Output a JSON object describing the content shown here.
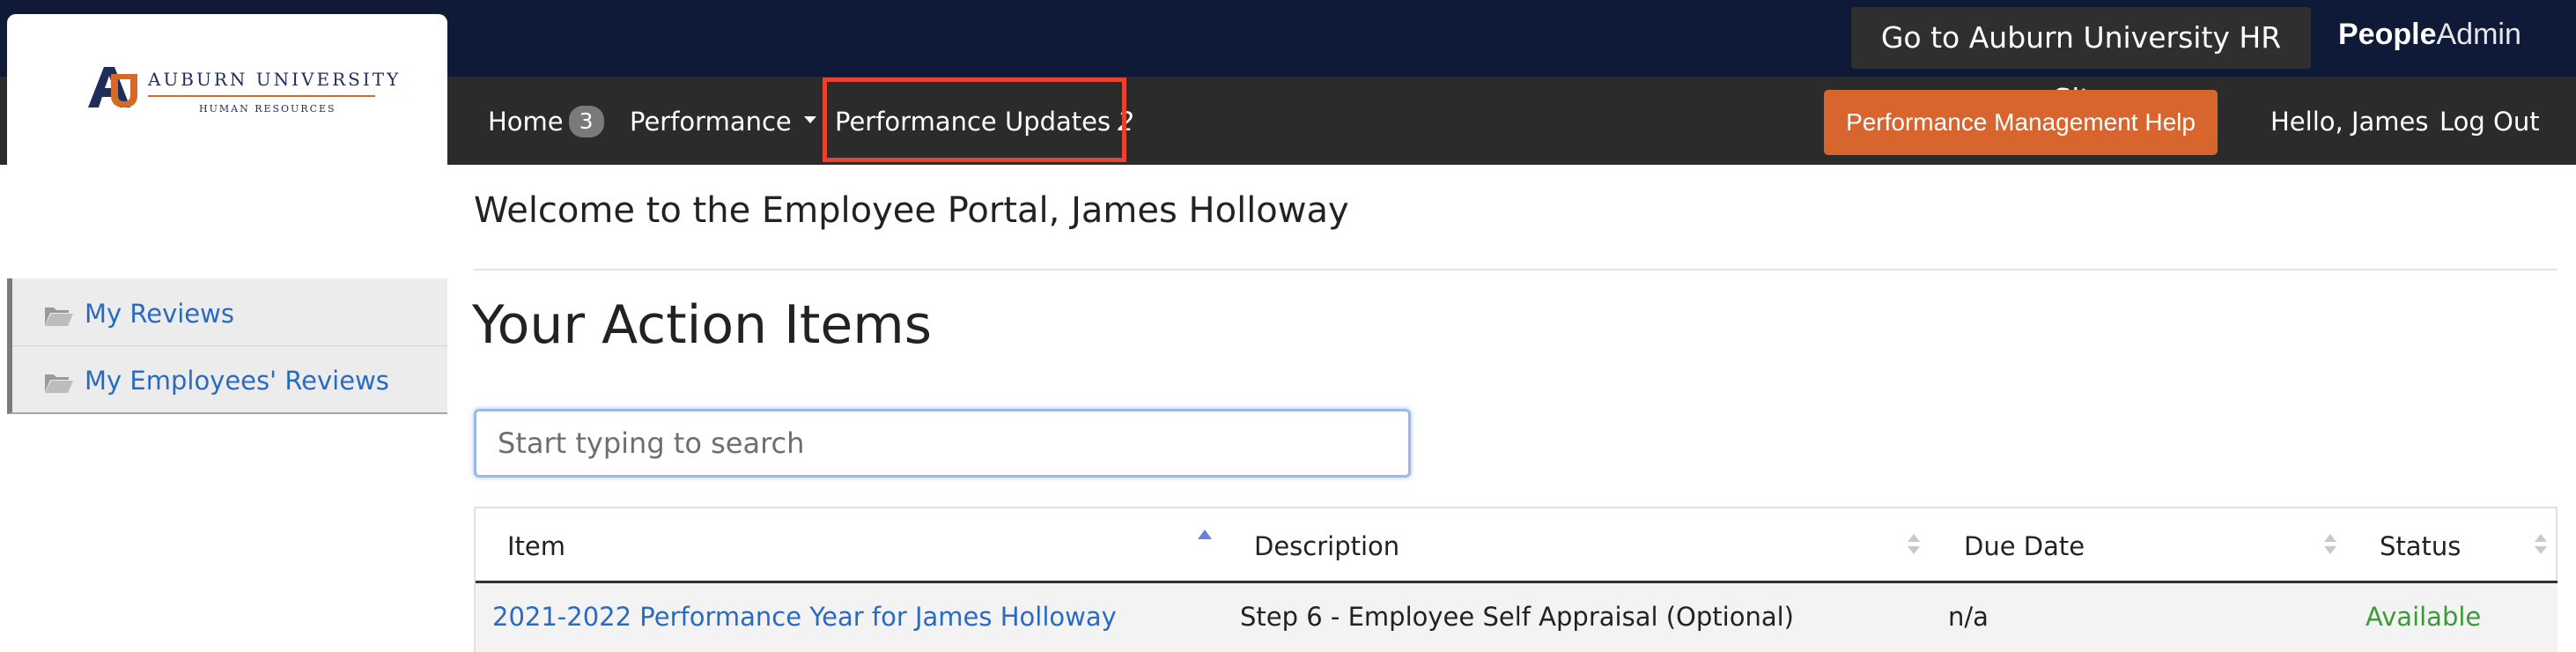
{
  "header": {
    "hr_site_button": "Go to Auburn University HR Site",
    "brand_bold": "People",
    "brand_light": "Admin"
  },
  "logo": {
    "line1": "AUBURN UNIVERSITY",
    "line2": "HUMAN RESOURCES"
  },
  "nav": {
    "home_label": "Home",
    "home_count": "3",
    "performance_label": "Performance",
    "updates_label": "Performance Updates",
    "updates_count": "2",
    "help_button": "Performance Management Help",
    "greeting": "Hello, James",
    "logout": "Log Out"
  },
  "sidebar": {
    "items": [
      {
        "label": "My Reviews",
        "icon": "folder-icon"
      },
      {
        "label": "My Employees' Reviews",
        "icon": "folder-icon"
      }
    ]
  },
  "main": {
    "welcome": "Welcome to the Employee Portal, James Holloway",
    "action_title": "Your Action Items",
    "search_placeholder": "Start typing to search"
  },
  "table": {
    "headers": [
      "Item",
      "Description",
      "Due Date",
      "Status"
    ],
    "rows": [
      {
        "item": "2021-2022 Performance Year for James Holloway",
        "description": "Step 6 - Employee Self Appraisal (Optional)",
        "due_date": "n/a",
        "status": "Available"
      }
    ]
  },
  "colors": {
    "top_bar": "#0e1a38",
    "nav_bar": "#2b2b2b",
    "help_button": "#d8652e",
    "link": "#2a6bc2",
    "status_available": "#3a9a3a",
    "highlight": "#e8432e"
  }
}
